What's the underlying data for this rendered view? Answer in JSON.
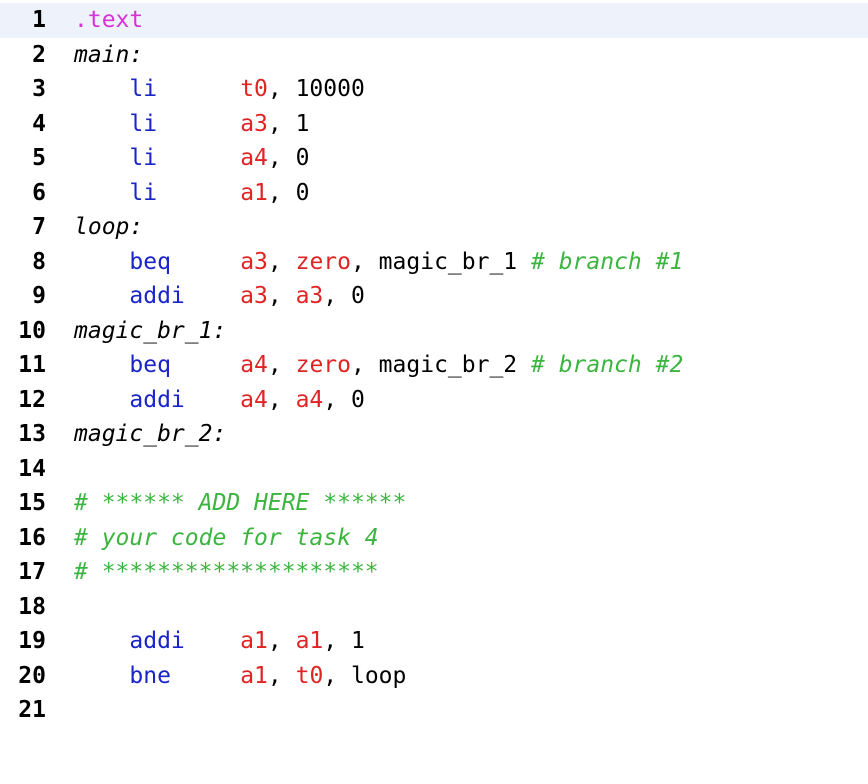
{
  "editor": {
    "colors": {
      "directive": "#d633d6",
      "instruction": "#1a24c9",
      "register": "#e02424",
      "comment": "#3cb540",
      "label": "#000000",
      "current_line_bg": "#eef2fb"
    },
    "lines": [
      {
        "number": "1",
        "tokens": [
          {
            "t": ".text",
            "k": "directive"
          }
        ]
      },
      {
        "number": "2",
        "tokens": [
          {
            "t": "main:",
            "k": "label"
          }
        ]
      },
      {
        "number": "3",
        "tokens": [
          {
            "t": "    ",
            "k": "plain"
          },
          {
            "t": "li",
            "k": "instr"
          },
          {
            "t": "      ",
            "k": "plain"
          },
          {
            "t": "t0",
            "k": "reg"
          },
          {
            "t": ", 10000",
            "k": "plain"
          }
        ]
      },
      {
        "number": "4",
        "tokens": [
          {
            "t": "    ",
            "k": "plain"
          },
          {
            "t": "li",
            "k": "instr"
          },
          {
            "t": "      ",
            "k": "plain"
          },
          {
            "t": "a3",
            "k": "reg"
          },
          {
            "t": ", 1",
            "k": "plain"
          }
        ]
      },
      {
        "number": "5",
        "tokens": [
          {
            "t": "    ",
            "k": "plain"
          },
          {
            "t": "li",
            "k": "instr"
          },
          {
            "t": "      ",
            "k": "plain"
          },
          {
            "t": "a4",
            "k": "reg"
          },
          {
            "t": ", 0",
            "k": "plain"
          }
        ]
      },
      {
        "number": "6",
        "tokens": [
          {
            "t": "    ",
            "k": "plain"
          },
          {
            "t": "li",
            "k": "instr"
          },
          {
            "t": "      ",
            "k": "plain"
          },
          {
            "t": "a1",
            "k": "reg"
          },
          {
            "t": ", 0",
            "k": "plain"
          }
        ]
      },
      {
        "number": "7",
        "tokens": [
          {
            "t": "loop:",
            "k": "label"
          }
        ]
      },
      {
        "number": "8",
        "tokens": [
          {
            "t": "    ",
            "k": "plain"
          },
          {
            "t": "beq",
            "k": "instr"
          },
          {
            "t": "     ",
            "k": "plain"
          },
          {
            "t": "a3",
            "k": "reg"
          },
          {
            "t": ", ",
            "k": "plain"
          },
          {
            "t": "zero",
            "k": "reg"
          },
          {
            "t": ", magic_br_1 ",
            "k": "plain"
          },
          {
            "t": "# branch #1",
            "k": "comment"
          }
        ]
      },
      {
        "number": "9",
        "tokens": [
          {
            "t": "    ",
            "k": "plain"
          },
          {
            "t": "addi",
            "k": "instr"
          },
          {
            "t": "    ",
            "k": "plain"
          },
          {
            "t": "a3",
            "k": "reg"
          },
          {
            "t": ", ",
            "k": "plain"
          },
          {
            "t": "a3",
            "k": "reg"
          },
          {
            "t": ", 0",
            "k": "plain"
          }
        ]
      },
      {
        "number": "10",
        "tokens": [
          {
            "t": "magic_br_1:",
            "k": "label"
          }
        ]
      },
      {
        "number": "11",
        "tokens": [
          {
            "t": "    ",
            "k": "plain"
          },
          {
            "t": "beq",
            "k": "instr"
          },
          {
            "t": "     ",
            "k": "plain"
          },
          {
            "t": "a4",
            "k": "reg"
          },
          {
            "t": ", ",
            "k": "plain"
          },
          {
            "t": "zero",
            "k": "reg"
          },
          {
            "t": ", magic_br_2 ",
            "k": "plain"
          },
          {
            "t": "# branch #2",
            "k": "comment"
          }
        ]
      },
      {
        "number": "12",
        "tokens": [
          {
            "t": "    ",
            "k": "plain"
          },
          {
            "t": "addi",
            "k": "instr"
          },
          {
            "t": "    ",
            "k": "plain"
          },
          {
            "t": "a4",
            "k": "reg"
          },
          {
            "t": ", ",
            "k": "plain"
          },
          {
            "t": "a4",
            "k": "reg"
          },
          {
            "t": ", 0",
            "k": "plain"
          }
        ]
      },
      {
        "number": "13",
        "tokens": [
          {
            "t": "magic_br_2:",
            "k": "label"
          }
        ]
      },
      {
        "number": "14",
        "tokens": []
      },
      {
        "number": "15",
        "tokens": [
          {
            "t": "# ****** ADD HERE ******",
            "k": "comment"
          }
        ]
      },
      {
        "number": "16",
        "tokens": [
          {
            "t": "# your code for task 4",
            "k": "comment"
          }
        ]
      },
      {
        "number": "17",
        "tokens": [
          {
            "t": "# ********************",
            "k": "comment"
          }
        ]
      },
      {
        "number": "18",
        "tokens": []
      },
      {
        "number": "19",
        "tokens": [
          {
            "t": "    ",
            "k": "plain"
          },
          {
            "t": "addi",
            "k": "instr"
          },
          {
            "t": "    ",
            "k": "plain"
          },
          {
            "t": "a1",
            "k": "reg"
          },
          {
            "t": ", ",
            "k": "plain"
          },
          {
            "t": "a1",
            "k": "reg"
          },
          {
            "t": ", 1",
            "k": "plain"
          }
        ]
      },
      {
        "number": "20",
        "tokens": [
          {
            "t": "    ",
            "k": "plain"
          },
          {
            "t": "bne",
            "k": "instr"
          },
          {
            "t": "     ",
            "k": "plain"
          },
          {
            "t": "a1",
            "k": "reg"
          },
          {
            "t": ", ",
            "k": "plain"
          },
          {
            "t": "t0",
            "k": "reg"
          },
          {
            "t": ", loop",
            "k": "plain"
          }
        ]
      },
      {
        "number": "21",
        "tokens": []
      }
    ]
  }
}
